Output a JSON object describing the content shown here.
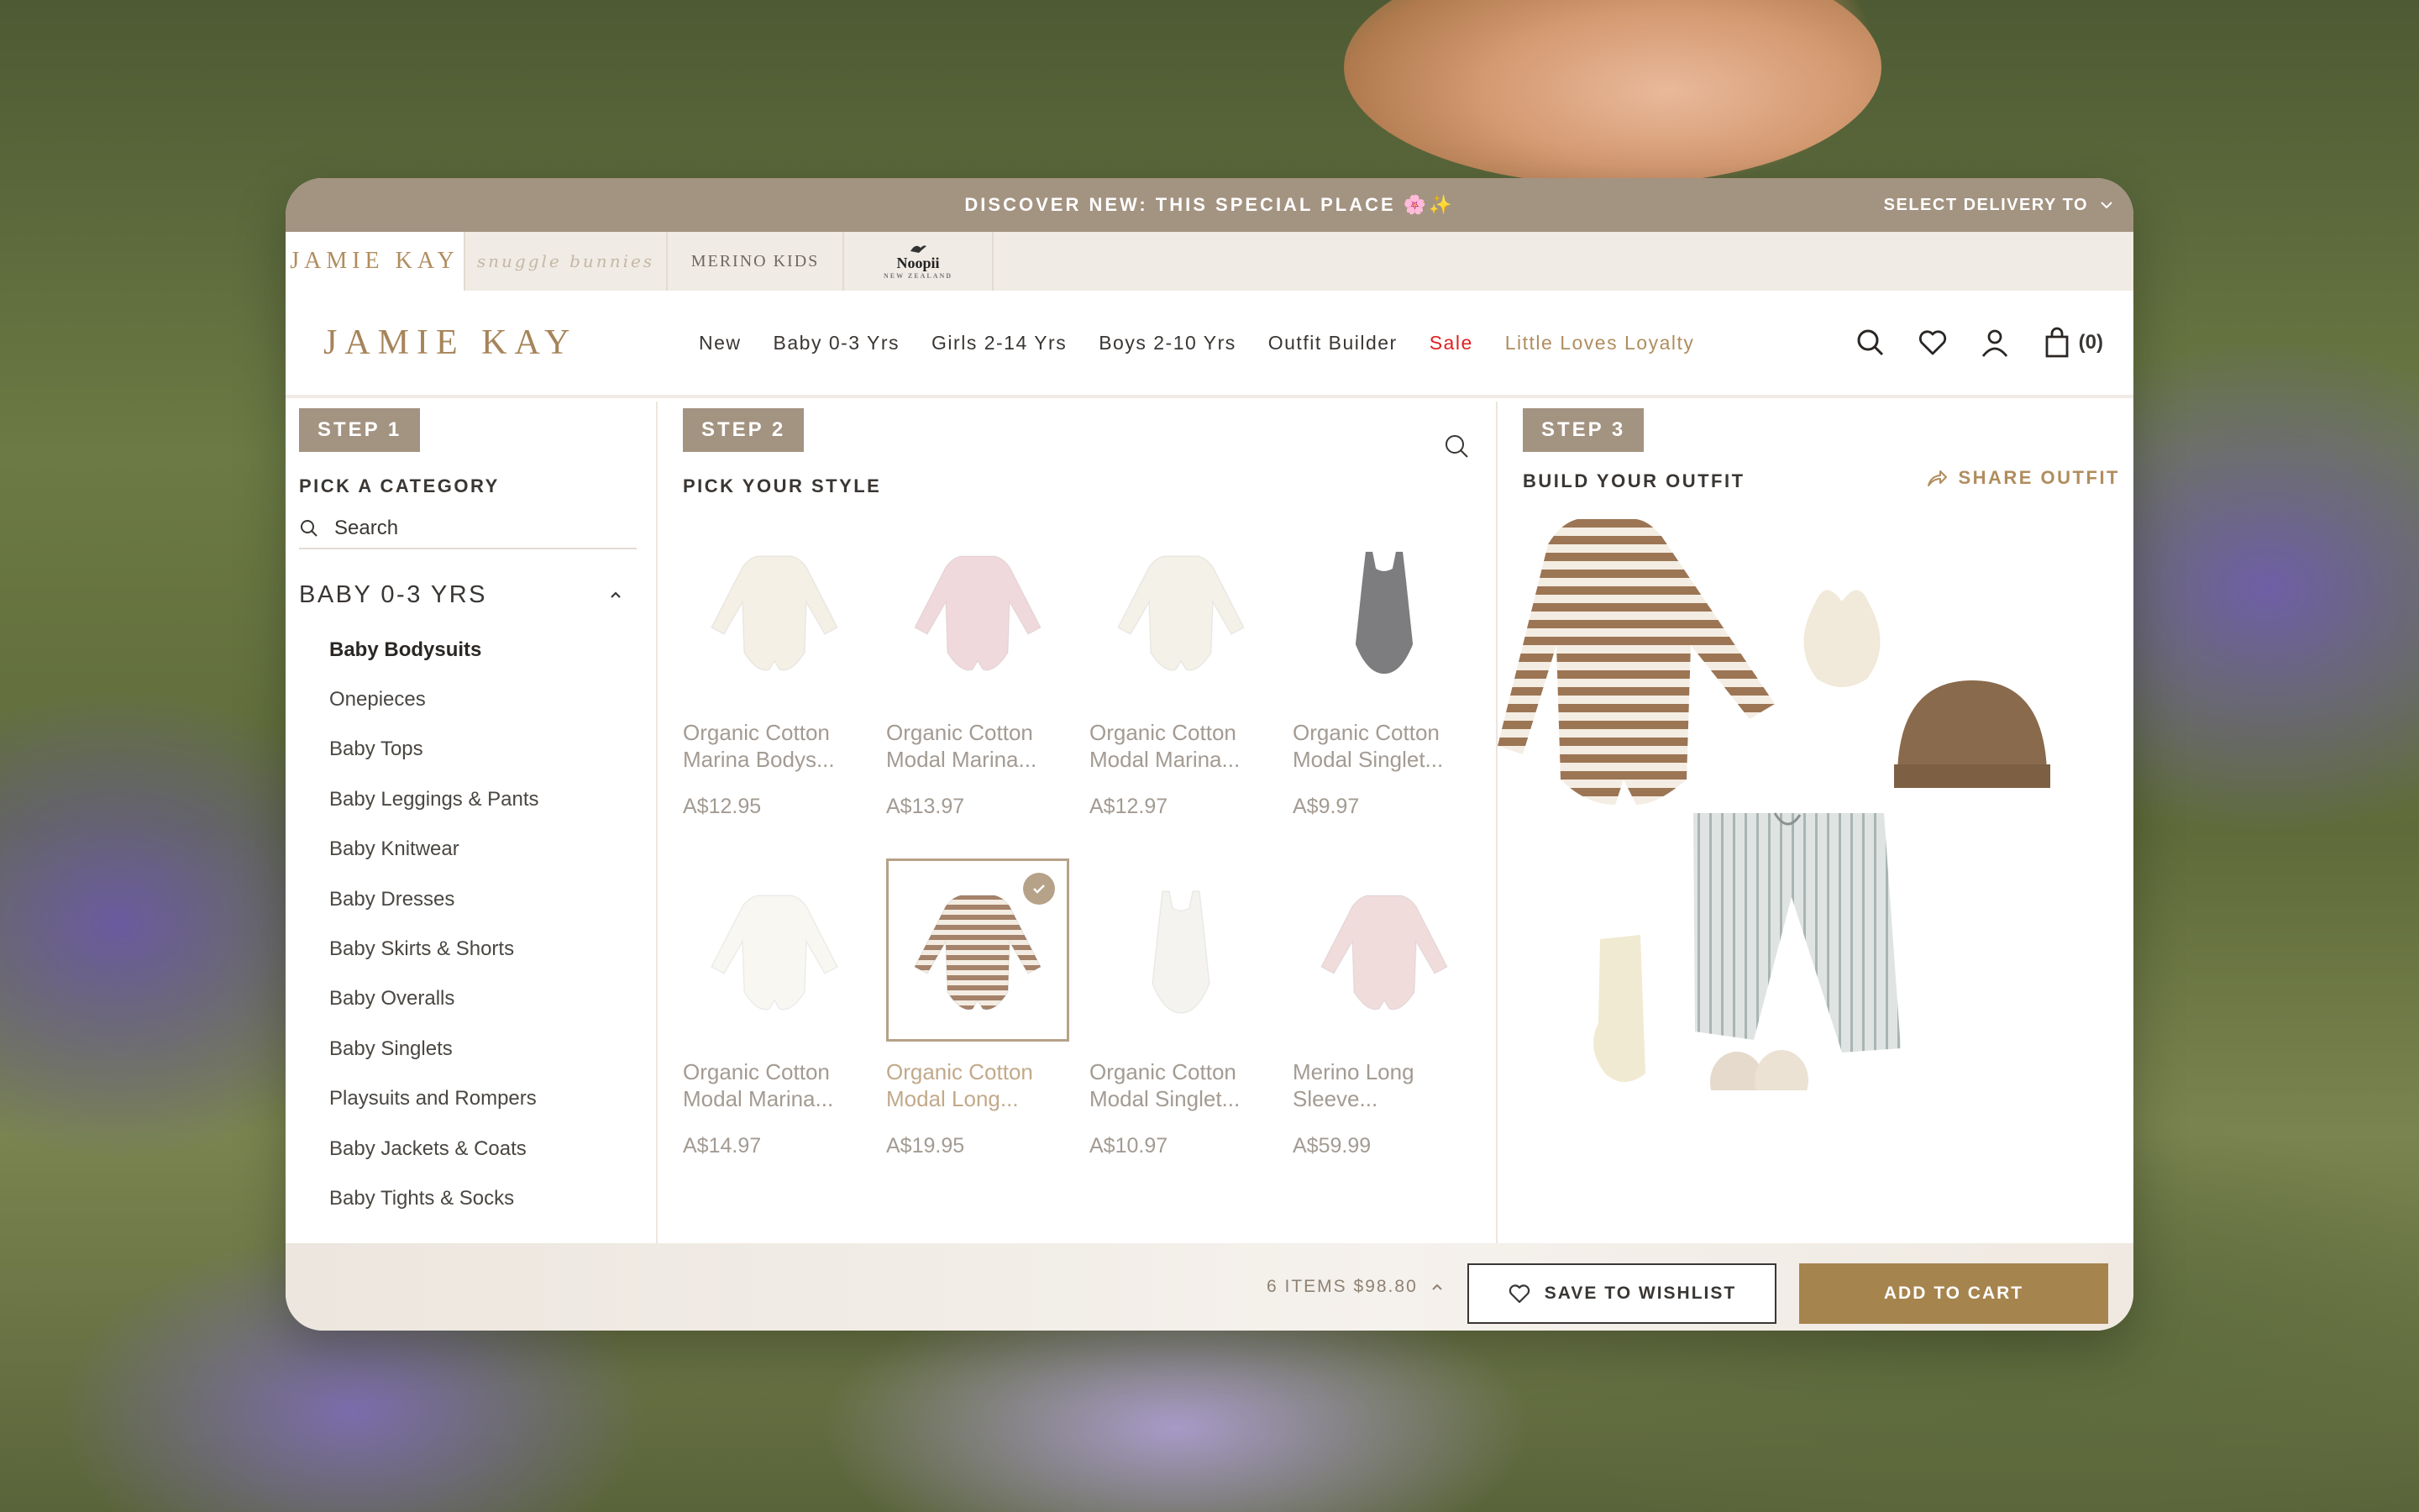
{
  "announcement": {
    "text": "DISCOVER NEW: THIS SPECIAL PLACE 🌸✨",
    "delivery_label": "SELECT DELIVERY TO"
  },
  "brand_tabs": [
    {
      "label": "JAMIE KAY"
    },
    {
      "label": "snuggle bunnies"
    },
    {
      "label": "MERINO KIDS"
    },
    {
      "label": "Noopii",
      "sub": "NEW ZEALAND"
    }
  ],
  "nav": {
    "logo": "JAMIE KAY",
    "links": [
      "New",
      "Baby 0-3 Yrs",
      "Girls 2-14 Yrs",
      "Boys 2-10 Yrs",
      "Outfit Builder",
      "Sale",
      "Little Loves Loyalty"
    ],
    "cart_count": "(0)"
  },
  "step1": {
    "badge": "STEP 1",
    "title": "PICK A CATEGORY",
    "search_placeholder": "Search",
    "category_head": "BABY 0-3 YRS",
    "items": [
      "Baby Bodysuits",
      "Onepieces",
      "Baby Tops",
      "Baby Leggings & Pants",
      "Baby Knitwear",
      "Baby Dresses",
      "Baby Skirts & Shorts",
      "Baby Overalls",
      "Baby Singlets",
      "Playsuits and Rompers",
      "Baby Jackets & Coats",
      "Baby Tights & Socks"
    ]
  },
  "step2": {
    "badge": "STEP 2",
    "title": "PICK YOUR STYLE",
    "products": [
      {
        "name": "Organic Cotton Marina Bodys...",
        "price": "A$12.95",
        "color": "#f5f0e6",
        "kind": "onesie-long"
      },
      {
        "name": "Organic Cotton Modal Marina...",
        "price": "A$13.97",
        "color": "#f0d9dc",
        "kind": "onesie-long"
      },
      {
        "name": "Organic Cotton Modal Marina...",
        "price": "A$12.97",
        "color": "#f4f1e8",
        "kind": "onesie-long"
      },
      {
        "name": "Organic Cotton Modal Singlet...",
        "price": "A$9.97",
        "color": "#7d7d7f",
        "kind": "singlet"
      },
      {
        "name": "Organic Cotton Modal Marina...",
        "price": "A$14.97",
        "color": "#f8f7f2",
        "kind": "onesie-long"
      },
      {
        "name": "Organic Cotton Modal Long...",
        "price": "A$19.95",
        "color": "#c8b09a",
        "kind": "onesie-stripe",
        "selected": true
      },
      {
        "name": "Organic Cotton Modal Singlet...",
        "price": "A$10.97",
        "color": "#f4f3ef",
        "kind": "singlet"
      },
      {
        "name": "Merino Long Sleeve...",
        "price": "A$59.99",
        "color": "#f1dcdc",
        "kind": "onesie-long"
      }
    ]
  },
  "step3": {
    "badge": "STEP 3",
    "title": "BUILD YOUR OUTFIT",
    "share_label": "SHARE OUTFIT",
    "zoom_in": "+",
    "zoom_out": "−"
  },
  "bottom": {
    "total": "6 ITEMS $98.80",
    "wishlist_label": "SAVE TO WISHLIST",
    "cart_label": "ADD TO CART"
  },
  "colors": {
    "accent": "#a39381",
    "gold": "#a6844e",
    "sale": "#e02020"
  }
}
